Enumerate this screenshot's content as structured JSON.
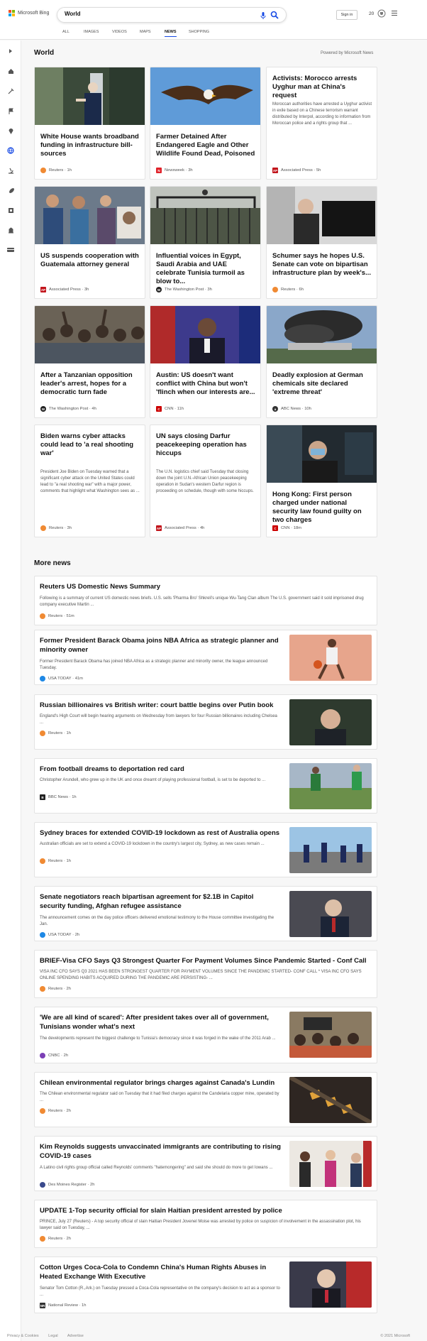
{
  "header": {
    "logo_text": "Microsoft Bing",
    "search_value": "World",
    "signin_label": "Sign in",
    "rewards_points": "20"
  },
  "tabs": [
    "ALL",
    "IMAGES",
    "VIDEOS",
    "MAPS",
    "NEWS",
    "SHOPPING"
  ],
  "active_tab": "NEWS",
  "rail_icons": [
    "expand-icon",
    "home-icon",
    "tools-icon",
    "flag-icon",
    "location-pin-icon",
    "globe-icon",
    "microscope-icon",
    "rocket-icon",
    "film-icon",
    "building-icon",
    "card-icon"
  ],
  "page": {
    "title": "World",
    "powered_by": "Powered by Microsoft News",
    "more_news_title": "More news"
  },
  "top_cards": [
    {
      "title": "White House wants broadband funding in infrastructure bill-sources",
      "source": "Reuters",
      "time": "1h",
      "src_color": "#f08a33"
    },
    {
      "title": "Farmer Detained After Endangered Eagle and Other Wildlife Found Dead, Poisoned",
      "source": "Newsweek",
      "time": "3h",
      "src_color": "#e0222a"
    },
    {
      "title": "Activists: Morocco arrests Uyghur man at China's request",
      "snippet": "Moroccan authorities have arrested a Uyghur activist in exile based on a Chinese terrorism warrant distributed by Interpol, according to information from Moroccan police and a rights group that ...",
      "source": "Associated Press",
      "time": "5h",
      "src_color": "#c2151c"
    },
    {
      "title": "US suspends cooperation with Guatemala attorney general",
      "source": "Associated Press",
      "time": "3h",
      "src_color": "#c2151c"
    },
    {
      "title": "Influential voices in Egypt, Saudi Arabia and UAE celebrate Tunisia turmoil as blow to...",
      "source": "The Washington Post",
      "time": "3h",
      "src_color": "#222222"
    },
    {
      "title": "Schumer says he hopes U.S. Senate can vote on bipartisan infrastructure plan by week's...",
      "source": "Reuters",
      "time": "6h",
      "src_color": "#f08a33"
    },
    {
      "title": "After a Tanzanian opposition leader's arrest, hopes for a democratic turn fade",
      "source": "The Washington Post",
      "time": "4h",
      "src_color": "#222222"
    },
    {
      "title": "Austin: US doesn't want conflict with China but won't 'flinch when our interests are...",
      "source": "CNN",
      "time": "11h",
      "src_color": "#cc0000"
    },
    {
      "title": "Deadly explosion at German chemicals site declared 'extreme threat'",
      "source": "ABC News",
      "time": "10h",
      "src_color": "#333333"
    },
    {
      "title": "Biden warns cyber attacks could lead to 'a real shooting war'",
      "snippet": "President Joe Biden on Tuesday warned that a significant cyber attack on the United States could lead to \"a real shooting war\" with a major power, comments that highlight what Washington sees as ...",
      "source": "Reuters",
      "time": "3h",
      "src_color": "#f08a33"
    },
    {
      "title": "UN says closing Darfur peacekeeping operation has hiccups",
      "snippet": "The U.N. logistics chief said Tuesday that closing down the joint U.N.-African Union peacekeeping operation in Sudan's western Darfur region is proceeding on schedule, though with some hiccups.",
      "source": "Associated Press",
      "time": "4h",
      "src_color": "#c2151c"
    },
    {
      "title": "Hong Kong: First person charged under national security law found guilty on two charges",
      "source": "CNN",
      "time": "18m",
      "src_color": "#cc0000"
    }
  ],
  "more_news": [
    {
      "title": "Reuters US Domestic News Summary",
      "snippet": "Following is a summary of current US domestic news briefs. U.S. sells 'Pharma Bro' Shkreli's unique Wu-Tang Clan album The U.S. government said it sold imprisoned drug company executive Martin ...",
      "source": "Reuters",
      "time": "51m",
      "src_color": "#f08a33"
    },
    {
      "title": "Former President Barack Obama joins NBA Africa as strategic planner and minority owner",
      "snippet": "Former President Barack Obama has joined NBA Africa as a strategic planner and minority owner, the league announced Tuesday.",
      "source": "USA TODAY",
      "time": "41m",
      "src_color": "#1e88e5"
    },
    {
      "title": "Russian billionaires vs British writer: court battle begins over Putin book",
      "snippet": "England's High Court will begin hearing arguments on Wednesday from lawyers for four Russian billionaires including Chelsea ...",
      "source": "Reuters",
      "time": "1h",
      "src_color": "#f08a33"
    },
    {
      "title": "From football dreams to deportation red card",
      "snippet": "Christopher Arundell, who grew up in the UK and once dreamt of playing professional football, is set to be deported to ...",
      "source": "BBC News",
      "time": "1h",
      "src_color": "#222222"
    },
    {
      "title": "Sydney braces for extended COVID-19 lockdown as rest of Australia opens",
      "snippet": "Australian officials are set to extend a COVID-19 lockdown in the country's largest city, Sydney, as new cases remain ...",
      "source": "Reuters",
      "time": "1h",
      "src_color": "#f08a33"
    },
    {
      "title": "Senate negotiators reach bipartisan agreement for $2.1B in Capitol security funding, Afghan refugee assistance",
      "snippet": "The announcement comes on the day police officers delivered emotional testimony to the House committee investigating the Jan.",
      "source": "USA TODAY",
      "time": "2h",
      "src_color": "#1e88e5"
    },
    {
      "title": "BRIEF-Visa CFO Says Q3 Strongest Quarter For Payment Volumes Since Pandemic Started - Conf Call",
      "snippet": "VISA INC CFO SAYS Q3 2021 HAS BEEN STRONGEST QUARTER FOR PAYMENT VOLUMES SINCE THE PANDEMIC STARTED- CONF CALL * VISA INC CFO SAYS ONLINE SPENDING HABITS ACQUIRED DURING THE PANDEMIC ARE PERSISTING- ...",
      "source": "Reuters",
      "time": "2h",
      "src_color": "#f08a33"
    },
    {
      "title": "'We are all kind of scared': After president takes over all of government, Tunisians wonder what's next",
      "snippet": "The developments represent the biggest challenge to Tunisia's democracy since it was forged in the wake of the 2011 Arab ...",
      "source": "CNBC",
      "time": "2h",
      "src_color": "#7b3fb5"
    },
    {
      "title": "Chilean environmental regulator brings charges against Canada's Lundin",
      "snippet": "The Chilean environmental regulator said on Tuesday that it had filed charges against the Candelaria copper mine, operated by ...",
      "source": "Reuters",
      "time": "2h",
      "src_color": "#f08a33"
    },
    {
      "title": "Kim Reynolds suggests unvaccinated immigrants are contributing to rising COVID-19 cases",
      "snippet": "A Latino civil rights group official called Reynolds' comments \"hatemongering\" and said she should do more to get Iowans ...",
      "source": "Des Moines Register",
      "time": "2h",
      "src_color": "#3a4a8c"
    },
    {
      "title": "UPDATE 1-Top security official for slain Haitian president arrested by police",
      "snippet": "PRINCE, July 27 (Reuters) - A top security official of slain Haitian President Jovenel Moise was arrested by police on suspicion of involvement in the assassination plot, his lawyer said on Tuesday, ...",
      "source": "Reuters",
      "time": "2h",
      "src_color": "#f08a33"
    },
    {
      "title": "Cotton Urges Coca-Cola to Condemn China's Human Rights Abuses in Heated Exchange With Executive",
      "snippet": "Senator Tom Cotton (R.,Ark.) on Tuesday pressed a Coca-Cola representative on the company's decision to act as a sponsor to ...",
      "source": "National Review",
      "time": "1h",
      "src_color": "#333333"
    }
  ],
  "footer": {
    "text_left": "Privacy & Cookies",
    "text_mid": "Legal",
    "text_right": "Advertise",
    "text_far": "© 2021 Microsoft"
  }
}
